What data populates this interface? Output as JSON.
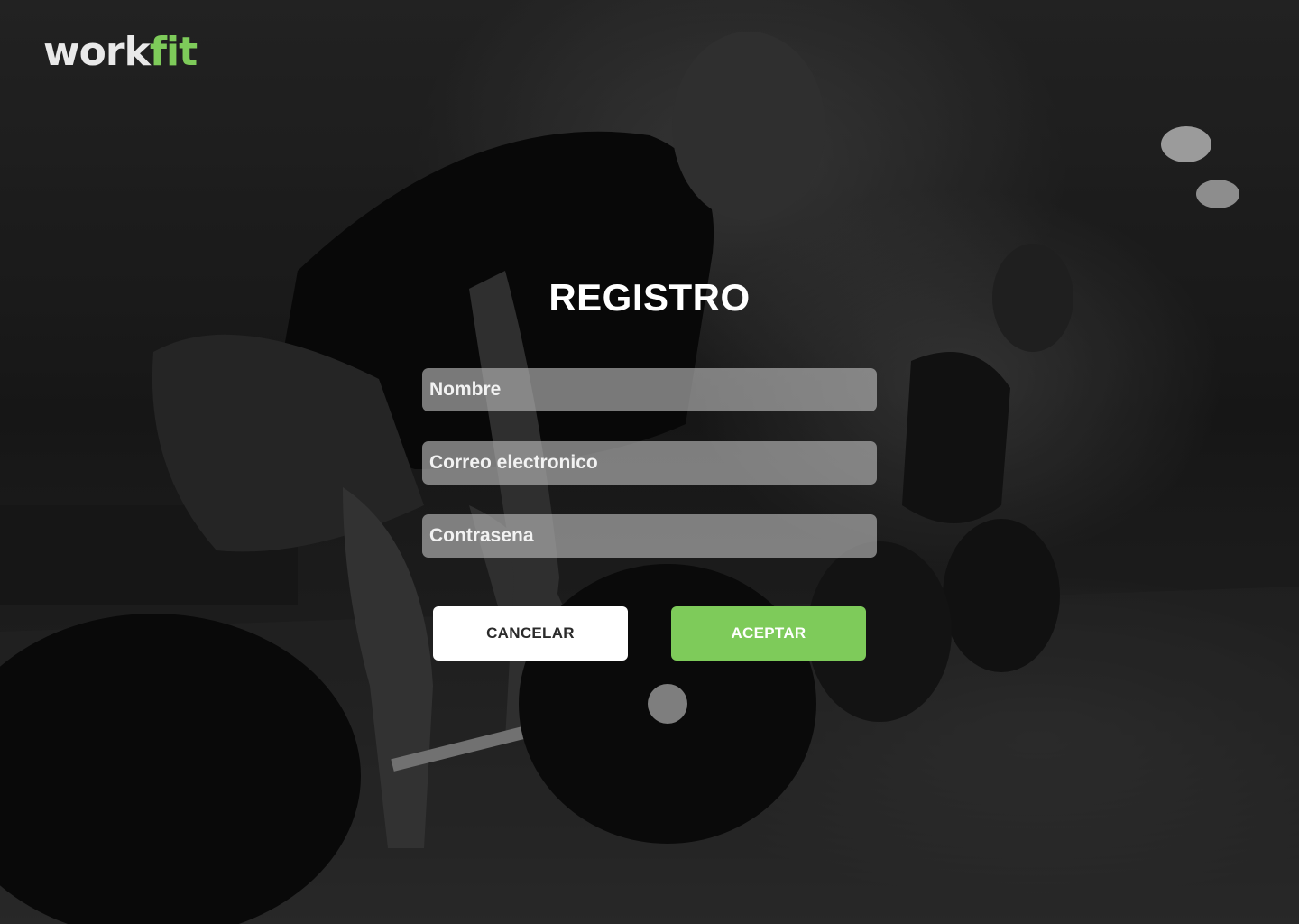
{
  "brand": {
    "logo_part1": "work",
    "logo_part2": "fit",
    "accent_color": "#7ecb5a"
  },
  "form": {
    "title": "REGISTRO",
    "fields": [
      {
        "placeholder": "Nombre",
        "value": ""
      },
      {
        "placeholder": "Correo electronico",
        "value": ""
      },
      {
        "placeholder": "Contrasena",
        "value": ""
      }
    ],
    "cancel_label": "CANCELAR",
    "accept_label": "ACEPTAR"
  },
  "background": {
    "icon": "gym-deadlift-photo"
  }
}
